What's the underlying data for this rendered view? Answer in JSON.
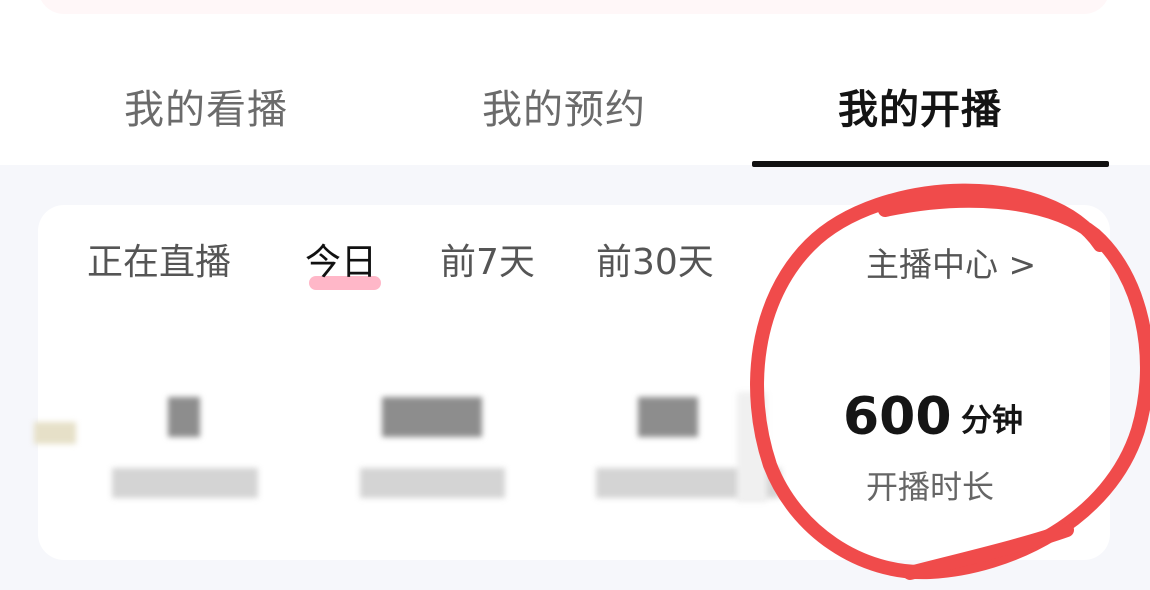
{
  "tabs": [
    {
      "label": "我的看播",
      "active": false
    },
    {
      "label": "我的预约",
      "active": false
    },
    {
      "label": "我的开播",
      "active": true
    }
  ],
  "filters": {
    "items": [
      "正在直播",
      "今日",
      "前7天",
      "前30天"
    ],
    "selected": "今日"
  },
  "anchor_center": {
    "label": "主播中心 >"
  },
  "stats": {
    "duration": {
      "value": "600",
      "unit": "分钟",
      "label": "开播时长"
    }
  },
  "colors": {
    "accent_pink": "#ffb7c8",
    "annotation_red": "#f04b4b",
    "active_tab": "#141414"
  }
}
